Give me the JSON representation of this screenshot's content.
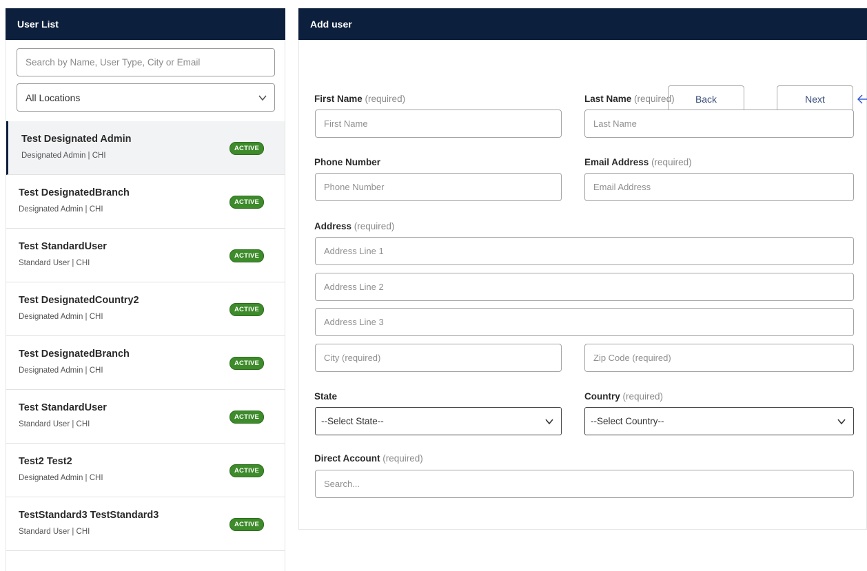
{
  "user_list": {
    "title": "User List",
    "search_placeholder": "Search by Name, User Type, City or Email",
    "location_filter": "All Locations",
    "users": [
      {
        "name": "Test Designated Admin",
        "subtitle": "Designated Admin | CHI",
        "status": "ACTIVE"
      },
      {
        "name": "Test DesignatedBranch",
        "subtitle": "Designated Admin | CHI",
        "status": "ACTIVE"
      },
      {
        "name": "Test StandardUser",
        "subtitle": "Standard User | CHI",
        "status": "ACTIVE"
      },
      {
        "name": "Test DesignatedCountry2",
        "subtitle": "Designated Admin | CHI",
        "status": "ACTIVE"
      },
      {
        "name": "Test DesignatedBranch",
        "subtitle": "Designated Admin | CHI",
        "status": "ACTIVE"
      },
      {
        "name": "Test StandardUser",
        "subtitle": "Standard User | CHI",
        "status": "ACTIVE"
      },
      {
        "name": "Test2 Test2",
        "subtitle": "Designated Admin | CHI",
        "status": "ACTIVE"
      },
      {
        "name": "TestStandard3 TestStandard3",
        "subtitle": "Standard User | CHI",
        "status": "ACTIVE"
      }
    ]
  },
  "add_user": {
    "title": "Add user",
    "back_label": "Back",
    "next_label": "Next",
    "first_name": {
      "label": "First Name",
      "req": "(required)",
      "placeholder": "First Name"
    },
    "last_name": {
      "label": "Last Name",
      "req": "(required)",
      "placeholder": "Last Name"
    },
    "phone": {
      "label": "Phone Number",
      "placeholder": "Phone Number"
    },
    "email": {
      "label": "Email Address",
      "req": "(required)",
      "placeholder": "Email Address"
    },
    "address": {
      "label": "Address",
      "req": "(required)",
      "line1_placeholder": "Address Line 1",
      "line2_placeholder": "Address Line 2",
      "line3_placeholder": "Address Line 3",
      "city_placeholder": "City (required)",
      "zip_placeholder": "Zip Code (required)"
    },
    "state": {
      "label": "State",
      "selected": "--Select State--"
    },
    "country": {
      "label": "Country",
      "req": "(required)",
      "selected": "--Select Country--"
    },
    "direct_account": {
      "label": "Direct Account",
      "req": "(required)",
      "placeholder": "Search..."
    }
  },
  "colors": {
    "header_bg": "#0c1f3d",
    "active_badge": "#3d8b2a",
    "button_text": "#3a4d7a",
    "arrow": "#2a4fd6"
  }
}
